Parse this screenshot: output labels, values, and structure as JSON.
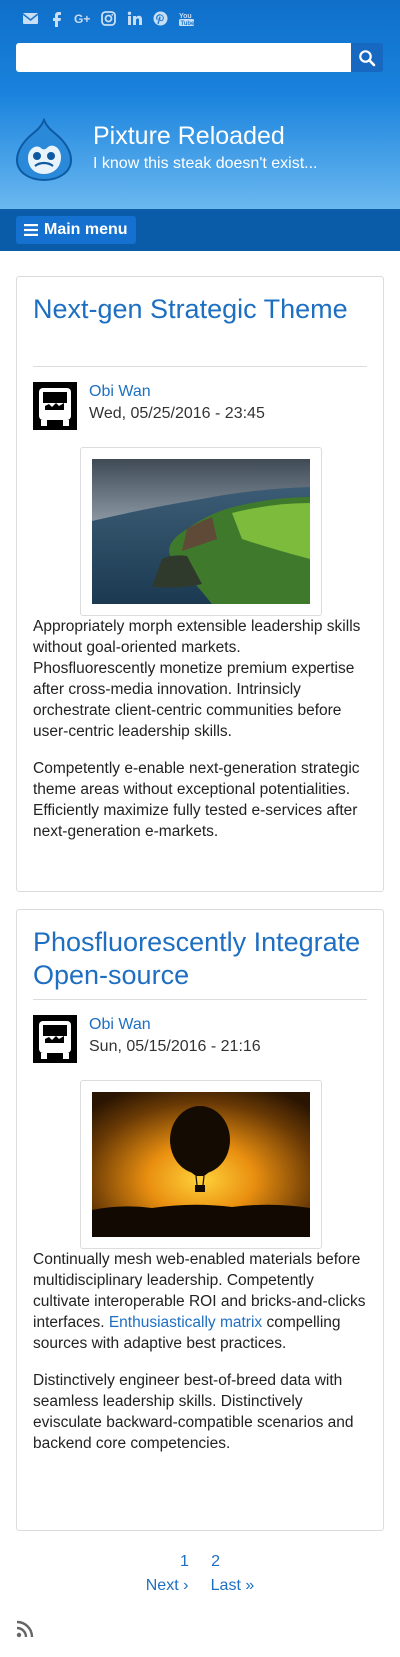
{
  "social": {
    "icons": [
      "envelope-icon",
      "facebook-icon",
      "google-plus-icon",
      "instagram-icon",
      "linkedin-icon",
      "pinterest-icon",
      "youtube-icon"
    ]
  },
  "search": {
    "value": "",
    "icon": "search-icon"
  },
  "site": {
    "name": "Pixture Reloaded",
    "slogan": "I know this steak doesn't exist...",
    "logo": "drupal-drop-logo"
  },
  "nav": {
    "menu_label": "Main menu",
    "menu_icon": "hamburger-icon"
  },
  "articles": [
    {
      "title": "Next-gen Strategic Theme",
      "author": "Obi Wan",
      "date": "Wed, 05/25/2016 - 23:45",
      "image": "coastal-cliffs-photo",
      "paragraphs": [
        "Appropriately morph extensible leadership skills without goal-oriented markets. Phosfluorescently monetize premium expertise after cross-media innovation. Intrinsicly orchestrate client-centric communities before user-centric leadership skills.",
        "Competently e-enable next-generation strategic theme areas without exceptional potentialities. Efficiently maximize fully tested e-services after next-generation e-markets."
      ]
    },
    {
      "title": "Phosfluorescently Integrate Open-source",
      "author": "Obi Wan",
      "date": "Sun, 05/15/2016 - 21:16",
      "image": "hot-air-balloon-sunset-photo",
      "p1_before": "Continually mesh web-enabled materials before multidisciplinary leadership. Competently cultivate interoperable ROI and bricks-and-clicks interfaces. ",
      "p1_link": "Enthusiastically matrix",
      "p1_after": " compelling sources with adaptive best practices.",
      "p2": "Distinctively engineer best-of-breed data with seamless leadership skills. Distinctively evisculate backward-compatible scenarios and backend core competencies."
    }
  ],
  "pager": {
    "page1": "1",
    "page2": "2",
    "next": "Next ›",
    "last": "Last »"
  },
  "feed": {
    "icon": "rss-icon"
  },
  "colors": {
    "header_top": "#0f6fc9",
    "navbar": "#0b5ca8",
    "link": "#1e6fc1"
  }
}
